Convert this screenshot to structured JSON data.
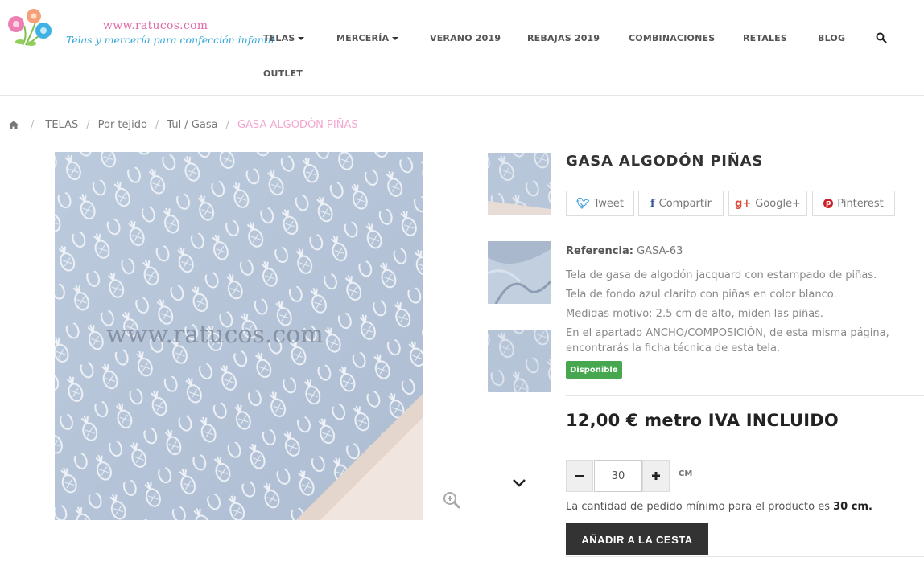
{
  "site": {
    "url": "www.ratucos.com",
    "tagline": "Telas y mercería para confección infantil"
  },
  "nav": {
    "items": [
      {
        "label": "TELAS",
        "dropdown": true
      },
      {
        "label": "MERCERÍA",
        "dropdown": true
      },
      {
        "label": "VERANO 2019",
        "dropdown": false
      },
      {
        "label": "REBAJAS 2019",
        "dropdown": false
      },
      {
        "label": "COMBINACIONES",
        "dropdown": false
      },
      {
        "label": "RETALES",
        "dropdown": false
      },
      {
        "label": "BLOG",
        "dropdown": false
      },
      {
        "label": "OUTLET",
        "dropdown": false
      }
    ],
    "search_icon": "search-icon"
  },
  "breadcrumb": {
    "home_icon": "home-icon",
    "items": [
      "TELAS",
      "Por tejido",
      "Tul / Gasa"
    ],
    "current": "GASA ALGODÓN PIÑAS",
    "separator": "/"
  },
  "product": {
    "image_watermark": "www.ratucos.com",
    "title": "GASA ALGODÓN PIÑAS",
    "share": [
      {
        "icon": "twitter-icon",
        "label": "Tweet"
      },
      {
        "icon": "facebook-icon",
        "label": "Compartir"
      },
      {
        "icon": "google-plus-icon",
        "label": "Google+"
      },
      {
        "icon": "pinterest-icon",
        "label": "Pinterest"
      }
    ],
    "reference_label": "Referencia:",
    "reference_value": "GASA-63",
    "description": [
      "Tela de gasa de algodón jacquard con estampado de piñas.",
      "Tela de fondo azul clarito con piñas en color blanco.",
      "Medidas motivo: 2.5 cm de alto, miden las piñas.",
      "En el apartado ANCHO/COMPOSICIÓN, de esta misma página,",
      "encontrarás la ficha técnica de esta tela."
    ],
    "availability": "Disponible",
    "price": "12,00 € metro IVA INCLUIDO",
    "quantity": "30",
    "quantity_unit": "CM",
    "min_order_text": "La cantidad de pedido mínimo para el producto es",
    "min_order_value": "30 cm.",
    "add_to_cart": "AÑADIR A LA CESTA"
  },
  "colors": {
    "fabric_blue": "#b9c7da",
    "pineapple": "#e9eef4",
    "accent_pink": "#f2a6cf",
    "available_green": "#46a74e",
    "button_dark": "#333333"
  }
}
